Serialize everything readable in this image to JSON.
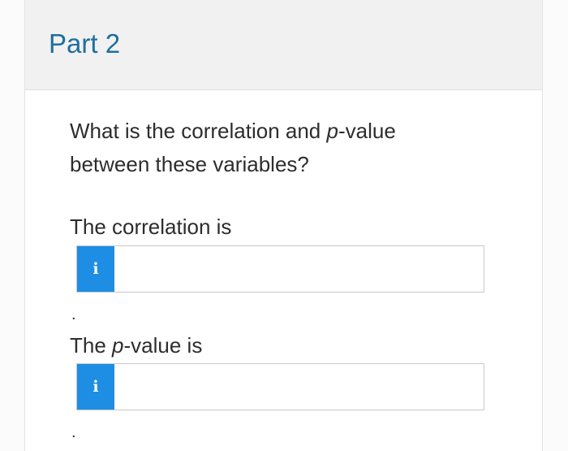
{
  "part": {
    "title": "Part 2"
  },
  "question": {
    "before_italic": "What is the correlation and ",
    "italic": "p",
    "after_italic": "-value between these variables?"
  },
  "correlation_field": {
    "label": "The correlation is",
    "info_icon_glyph": "i",
    "value": "",
    "trailing_punctuation": "."
  },
  "pvalue_field": {
    "label_before_italic": "The ",
    "label_italic": "p",
    "label_after_italic": "-value is",
    "info_icon_glyph": "i",
    "value": "",
    "trailing_punctuation": "."
  },
  "colors": {
    "title": "#1f6e9e",
    "info_button": "#1d8ee3",
    "header_bg": "#f1f1f1"
  }
}
